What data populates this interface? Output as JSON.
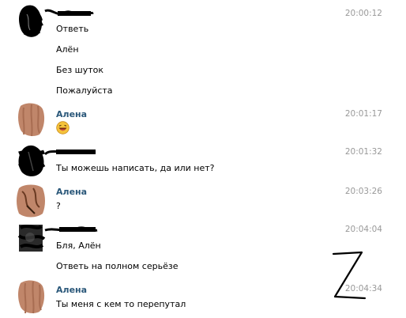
{
  "messages": [
    {
      "time": "20:00:12",
      "lines": [
        "Ответь",
        "Алён",
        "Без шуток",
        "Пожалуйста"
      ]
    },
    {
      "sender": "Алена",
      "time": "20:01:17",
      "emoji": "laughing-face"
    },
    {
      "time": "20:01:32",
      "lines": [
        "Ты можешь написать, да или нет?"
      ]
    },
    {
      "sender": "Алена",
      "time": "20:03:26",
      "lines": [
        "?"
      ]
    },
    {
      "time": "20:04:04",
      "lines": [
        "Бля, Алён",
        "Ответь на полном серьёзе"
      ]
    },
    {
      "sender": "Алена",
      "time": "20:04:34",
      "lines": [
        "Ты меня с кем то перепутал"
      ]
    }
  ],
  "colors": {
    "name": "#2b587a",
    "time": "#999999",
    "avatar_scribble": "#c0866a",
    "censor": "#000000"
  }
}
